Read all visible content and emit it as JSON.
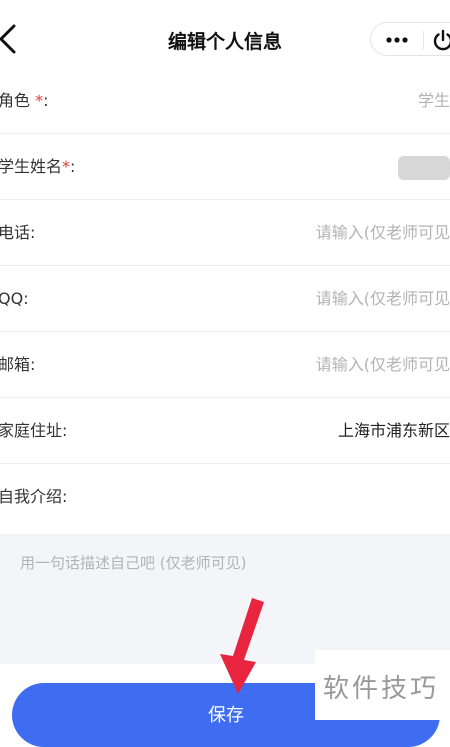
{
  "header": {
    "title": "编辑个人信息",
    "back_icon": "chevron-left-icon",
    "more_icon": "more-dots-icon",
    "power_icon": "power-icon"
  },
  "form": {
    "role": {
      "label": "角色",
      "required_mark": "*",
      "colon": ":",
      "value": "学生"
    },
    "student_name": {
      "label": "学生姓名",
      "required_mark": "*",
      "colon": ":"
    },
    "phone": {
      "label": "电话:",
      "placeholder": "请输入(仅老师可见"
    },
    "qq": {
      "label": "QQ:",
      "placeholder": "请输入(仅老师可见"
    },
    "email": {
      "label": "邮箱:",
      "placeholder": "请输入(仅老师可见"
    },
    "address": {
      "label": "家庭住址:",
      "value": "上海市浦东新区"
    },
    "intro": {
      "label": "自我介绍:",
      "placeholder": "用一句话描述自己吧 (仅老师可见)"
    }
  },
  "actions": {
    "save_label": "保存"
  },
  "watermark": {
    "text": "软件技巧"
  },
  "colors": {
    "primary": "#3f6df2",
    "required": "#e23b3b",
    "placeholder": "#b3b3b3",
    "annotation_arrow": "#e8243f",
    "textarea_bg": "#f4f5f9"
  }
}
